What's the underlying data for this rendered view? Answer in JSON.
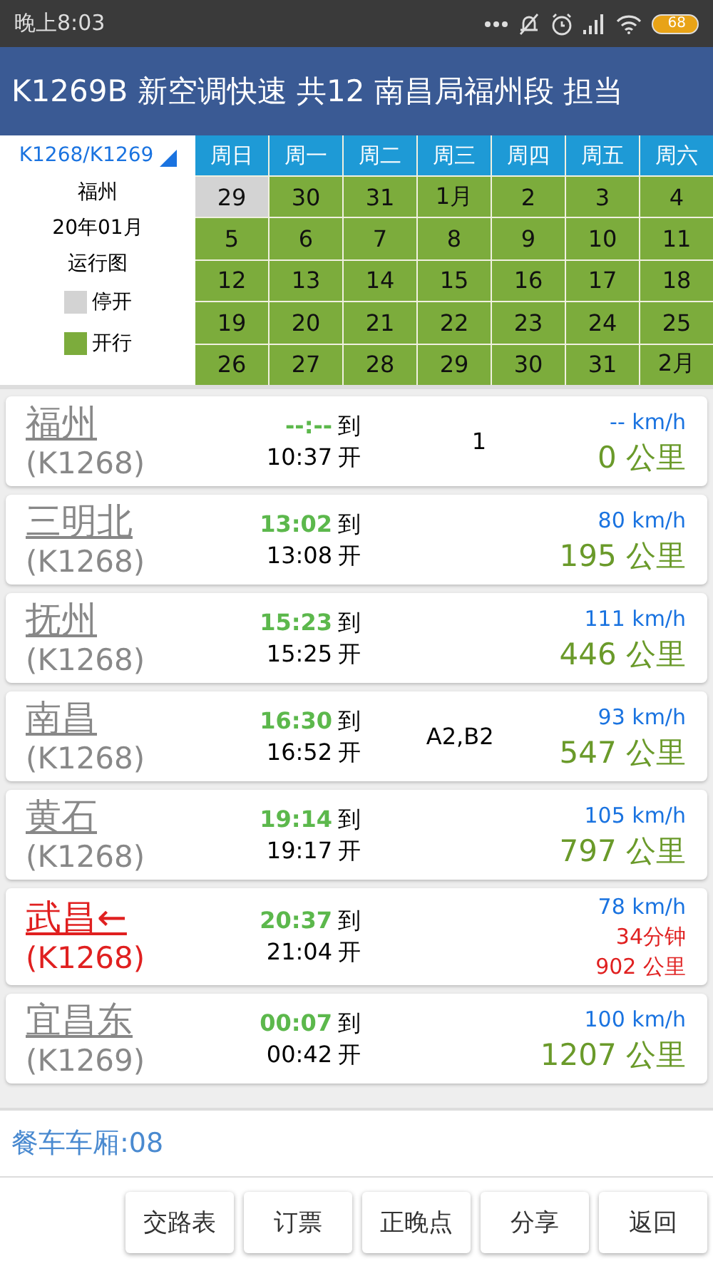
{
  "status_bar": {
    "time": "晚上8:03",
    "battery": "68"
  },
  "title": "K1269B 新空调快速 共12 南昌局福州段 担当",
  "calendar": {
    "train_selector": "K1268/K1269",
    "station": "福州",
    "month": "20年01月",
    "caption": "运行图",
    "legend": [
      {
        "label": "停开",
        "running": false
      },
      {
        "label": "开行",
        "running": true
      }
    ],
    "weekdays": [
      "周日",
      "周一",
      "周二",
      "周三",
      "周四",
      "周五",
      "周六"
    ],
    "weeks": [
      [
        {
          "day": "29",
          "running": false
        },
        {
          "day": "30",
          "running": true
        },
        {
          "day": "31",
          "running": true
        },
        {
          "day": "1月",
          "running": true
        },
        {
          "day": "2",
          "running": true
        },
        {
          "day": "3",
          "running": true
        },
        {
          "day": "4",
          "running": true
        }
      ],
      [
        {
          "day": "5",
          "running": true
        },
        {
          "day": "6",
          "running": true
        },
        {
          "day": "7",
          "running": true
        },
        {
          "day": "8",
          "running": true
        },
        {
          "day": "9",
          "running": true
        },
        {
          "day": "10",
          "running": true
        },
        {
          "day": "11",
          "running": true
        }
      ],
      [
        {
          "day": "12",
          "running": true
        },
        {
          "day": "13",
          "running": true
        },
        {
          "day": "14",
          "running": true
        },
        {
          "day": "15",
          "running": true
        },
        {
          "day": "16",
          "running": true
        },
        {
          "day": "17",
          "running": true
        },
        {
          "day": "18",
          "running": true
        }
      ],
      [
        {
          "day": "19",
          "running": true
        },
        {
          "day": "20",
          "running": true
        },
        {
          "day": "21",
          "running": true
        },
        {
          "day": "22",
          "running": true
        },
        {
          "day": "23",
          "running": true
        },
        {
          "day": "24",
          "running": true
        },
        {
          "day": "25",
          "running": true
        }
      ],
      [
        {
          "day": "26",
          "running": true
        },
        {
          "day": "27",
          "running": true
        },
        {
          "day": "28",
          "running": true
        },
        {
          "day": "29",
          "running": true
        },
        {
          "day": "30",
          "running": true
        },
        {
          "day": "31",
          "running": true
        },
        {
          "day": "2月",
          "running": true
        }
      ]
    ]
  },
  "stations": [
    {
      "name": "福州",
      "train": "(K1268)",
      "arrive": "--:--",
      "arrive_label": "到",
      "depart": "10:37",
      "depart_label": "开",
      "note": "1",
      "speed": "-- km/h",
      "distance": "0 公里",
      "current": false
    },
    {
      "name": "三明北",
      "train": "(K1268)",
      "arrive": "13:02",
      "arrive_label": "到",
      "depart": "13:08",
      "depart_label": "开",
      "speed": "80 km/h",
      "distance": "195 公里",
      "current": false
    },
    {
      "name": "抚州",
      "train": "(K1268)",
      "arrive": "15:23",
      "arrive_label": "到",
      "depart": "15:25",
      "depart_label": "开",
      "speed": "111 km/h",
      "distance": "446 公里",
      "current": false
    },
    {
      "name": "南昌",
      "train": "(K1268)",
      "arrive": "16:30",
      "arrive_label": "到",
      "depart": "16:52",
      "depart_label": "开",
      "note": "A2,B2",
      "speed": "93 km/h",
      "distance": "547 公里",
      "current": false
    },
    {
      "name": "黄石",
      "train": "(K1268)",
      "arrive": "19:14",
      "arrive_label": "到",
      "depart": "19:17",
      "depart_label": "开",
      "speed": "105 km/h",
      "distance": "797 公里",
      "current": false
    },
    {
      "name": "武昌←",
      "train": "(K1268)",
      "arrive": "20:37",
      "arrive_label": "到",
      "depart": "21:04",
      "depart_label": "开",
      "speed": "78 km/h",
      "delay": "34分钟",
      "distance": "902 公里",
      "current": true
    },
    {
      "name": "宜昌东",
      "train": "(K1269)",
      "arrive": "00:07",
      "arrive_label": "到",
      "depart": "00:42",
      "depart_label": "开",
      "speed": "100 km/h",
      "distance": "1207 公里",
      "current": false
    }
  ],
  "dining_car": "餐车车厢:08",
  "buttons": [
    "交路表",
    "订票",
    "正晚点",
    "分享",
    "返回"
  ]
}
